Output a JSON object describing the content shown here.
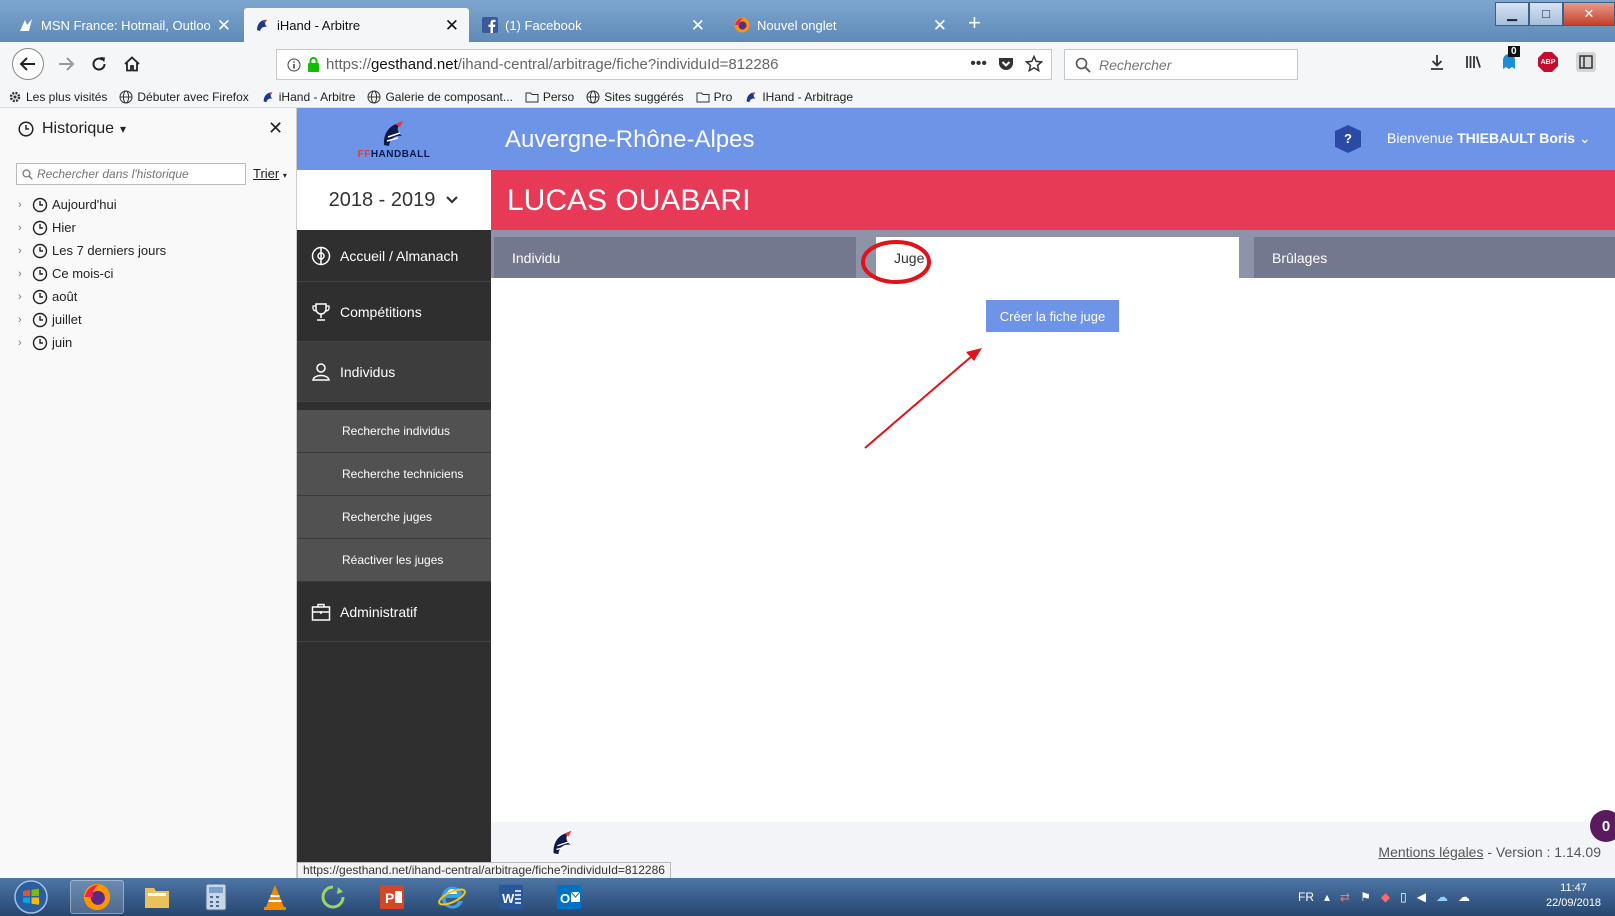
{
  "browser": {
    "tabs": [
      {
        "title": "MSN France: Hotmail, Outlook,",
        "icon": "msn-icon"
      },
      {
        "title": "iHand - Arbitre",
        "icon": "ffhandball-icon",
        "active": true
      },
      {
        "title": "(1) Facebook",
        "icon": "facebook-icon"
      },
      {
        "title": "Nouvel onglet",
        "icon": "firefox-icon"
      }
    ],
    "url": {
      "prefix": "https://",
      "host": "gesthand.net",
      "path": "/ihand-central/arbitrage/fiche?individuId=812286"
    },
    "search_placeholder": "Rechercher",
    "abp_label": "ABP",
    "notif_count": "0",
    "bookmarks": [
      "Les plus visités",
      "Débuter avec Firefox",
      "iHand - Arbitre",
      "Galerie de composant...",
      "Perso",
      "Sites suggérés",
      "Pro",
      "IHand - Arbitrage"
    ],
    "status_url": "https://gesthand.net/ihand-central/arbitrage/fiche?individuId=812286"
  },
  "history": {
    "title": "Historique",
    "search_placeholder": "Rechercher dans l'historique",
    "sort_label": "Trier",
    "items": [
      "Aujourd'hui",
      "Hier",
      "Les 7 derniers jours",
      "Ce mois-ci",
      "août",
      "juillet",
      "juin"
    ]
  },
  "app": {
    "logo_text_ff": "FF",
    "logo_text_rest": "HANDBALL",
    "region": "Auvergne-Rhône-Alpes",
    "help": "?",
    "welcome_prefix": "Bienvenue",
    "user": "THIEBAULT Boris",
    "season": "2018 - 2019",
    "person_name": "LUCAS OUABARI",
    "menu": [
      {
        "label": "Accueil / Almanach",
        "icon": "whistle-icon"
      },
      {
        "label": "Compétitions",
        "icon": "trophy-icon"
      },
      {
        "label": "Individus",
        "icon": "person-icon"
      },
      {
        "label": "Administratif",
        "icon": "briefcase-icon"
      }
    ],
    "submenu": [
      "Recherche individus",
      "Recherche techniciens",
      "Recherche juges",
      "Réactiver les juges"
    ],
    "tabs": [
      "Individu",
      "Juge",
      "Brûlages"
    ],
    "create_button": "Créer la fiche juge",
    "footer": {
      "legal": "Mentions légales",
      "version": "- Version : 1.14.09"
    },
    "chat_count": "0"
  },
  "taskbar": {
    "lang": "FR",
    "time": "11:47",
    "date": "22/09/2018"
  },
  "colors": {
    "accent_blue": "#6e94e8",
    "banner_red": "#e63a57",
    "menu_dark": "#2f2f2f",
    "annotation_red": "#e0121a"
  }
}
